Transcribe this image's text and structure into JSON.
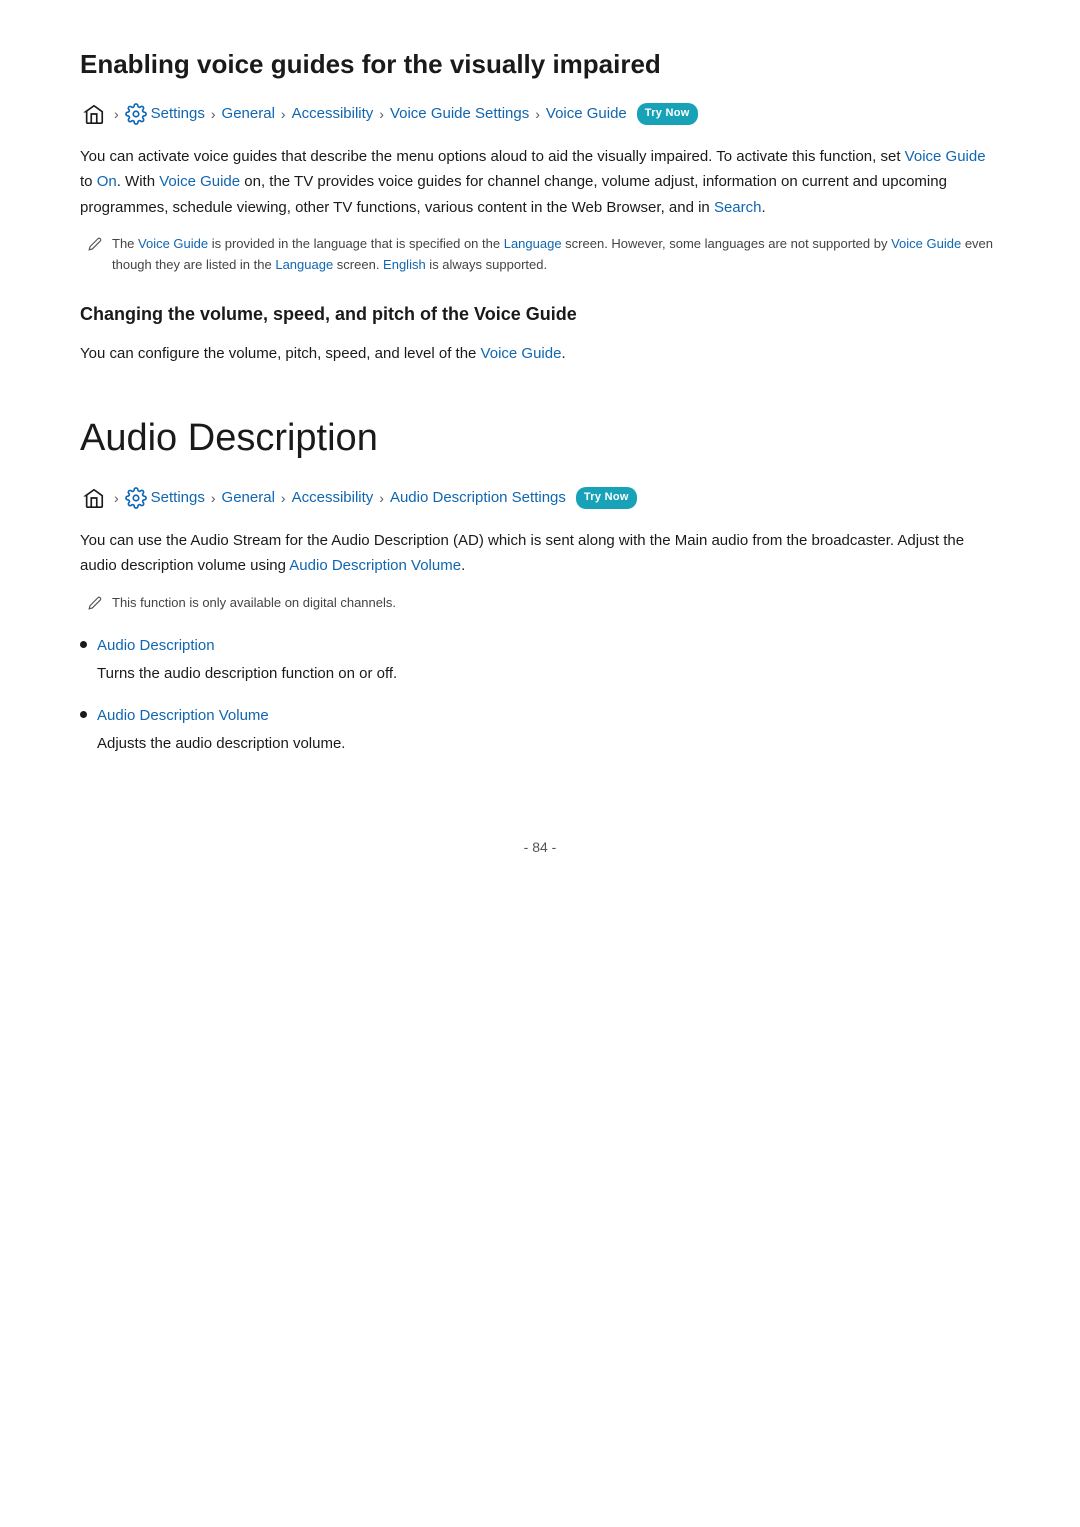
{
  "section1": {
    "title": "Enabling voice guides for the visually impaired",
    "breadcrumb": {
      "home_icon": "home",
      "settings_icon": "gear",
      "items": [
        "Settings",
        "General",
        "Accessibility",
        "Voice Guide Settings",
        "Voice Guide"
      ],
      "try_now_label": "Try Now"
    },
    "body1": "You can activate voice guides that describe the menu options aloud to aid the visually impaired. To activate this function, set ",
    "body1_link1": "Voice Guide",
    "body1_mid": " to ",
    "body1_link2": "On",
    "body1_after": ". With ",
    "body1_link3": "Voice Guide",
    "body1_end": " on, the TV provides voice guides for channel change, volume adjust, information on current and upcoming programmes, schedule viewing, other TV functions, various content in the Web Browser, and in ",
    "body1_link4": "Search",
    "body1_final": ".",
    "note": {
      "text_prefix": "The ",
      "link1": "Voice Guide",
      "text_mid1": " is provided in the language that is specified on the ",
      "link2": "Language",
      "text_mid2": " screen. However, some languages are not supported by ",
      "link3": "Voice Guide",
      "text_mid3": " even though they are listed in the ",
      "link4": "Language",
      "text_mid4": " screen. ",
      "link5": "English",
      "text_end": " is always supported."
    },
    "subheading": "Changing the volume, speed, and pitch of the Voice Guide",
    "body2_prefix": "You can configure the volume, pitch, speed, and level of the ",
    "body2_link": "Voice Guide",
    "body2_end": "."
  },
  "section2": {
    "title": "Audio Description",
    "breadcrumb": {
      "items": [
        "Settings",
        "General",
        "Accessibility",
        "Audio Description Settings"
      ],
      "try_now_label": "Try Now"
    },
    "body1": "You can use the Audio Stream for the Audio Description (AD) which is sent along with the Main audio from the broadcaster. Adjust the audio description volume using ",
    "body1_link": "Audio Description Volume",
    "body1_end": ".",
    "note_text": "This function is only available on digital channels.",
    "bullets": [
      {
        "title": "Audio Description",
        "desc": "Turns the audio description function on or off."
      },
      {
        "title": "Audio Description Volume",
        "desc": "Adjusts the audio description volume."
      }
    ]
  },
  "footer": {
    "page_number": "- 84 -"
  },
  "colors": {
    "link": "#1066b0",
    "badge_bg": "#17a2b8",
    "badge_text": "#ffffff",
    "text_main": "#1a1a1a",
    "text_note": "#444444"
  }
}
